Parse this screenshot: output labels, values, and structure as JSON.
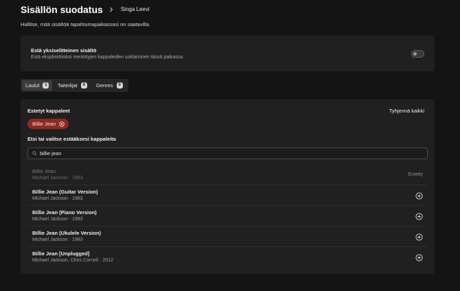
{
  "header": {
    "title": "Sisällön suodatus",
    "current_location": "Singa Leevi"
  },
  "description": "Hallitse, mitä sisältöä tapahtumapaikassasi on saatavilla.",
  "explicit": {
    "title": "Estä yksiselitteinen sisältö",
    "subtitle": "Estä eksplisiittisiksi merkittyjen kappaleiden soittaminen tässä paikassa.",
    "enabled": false
  },
  "tabs": [
    {
      "label": "Laulut",
      "count": "1",
      "active": true
    },
    {
      "label": "Taiteilijat",
      "count": "0",
      "active": false
    },
    {
      "label": "Genres",
      "count": "0",
      "active": false
    }
  ],
  "blocked": {
    "title": "Estetyt kappaleet",
    "clear_all": "Tyhjennä kaikki",
    "chips": [
      {
        "label": "Billie Jean"
      }
    ]
  },
  "search": {
    "label": "Etsi tai valitse estääksesi kappaleita",
    "value": "billie jean"
  },
  "results": [
    {
      "title": "Billie Jean",
      "meta": "Michael Jackson · 1983",
      "blocked": true,
      "status": "Estetty"
    },
    {
      "title": "Billie Jean (Guitar Version)",
      "meta": "Michael Jackson · 1983",
      "blocked": false
    },
    {
      "title": "Billie Jean (Piano Version)",
      "meta": "Michael Jackson · 1983",
      "blocked": false
    },
    {
      "title": "Billie Jean (Ukulele Version)",
      "meta": "Michael Jackson · 1983",
      "blocked": false
    },
    {
      "title": "Billie Jean [Unplugged]",
      "meta": "Michael Jackson, Chris Cornell · 2012",
      "blocked": false
    }
  ],
  "icons": {
    "breadcrumb_separator": "chevron-right-icon",
    "chip_remove": "close-circle-icon",
    "search": "search-icon",
    "add": "plus-circle-icon"
  },
  "colors": {
    "background": "#141414",
    "card": "#202020",
    "chip_bg": "#8e2a22",
    "badge": "#d6d6d6"
  }
}
